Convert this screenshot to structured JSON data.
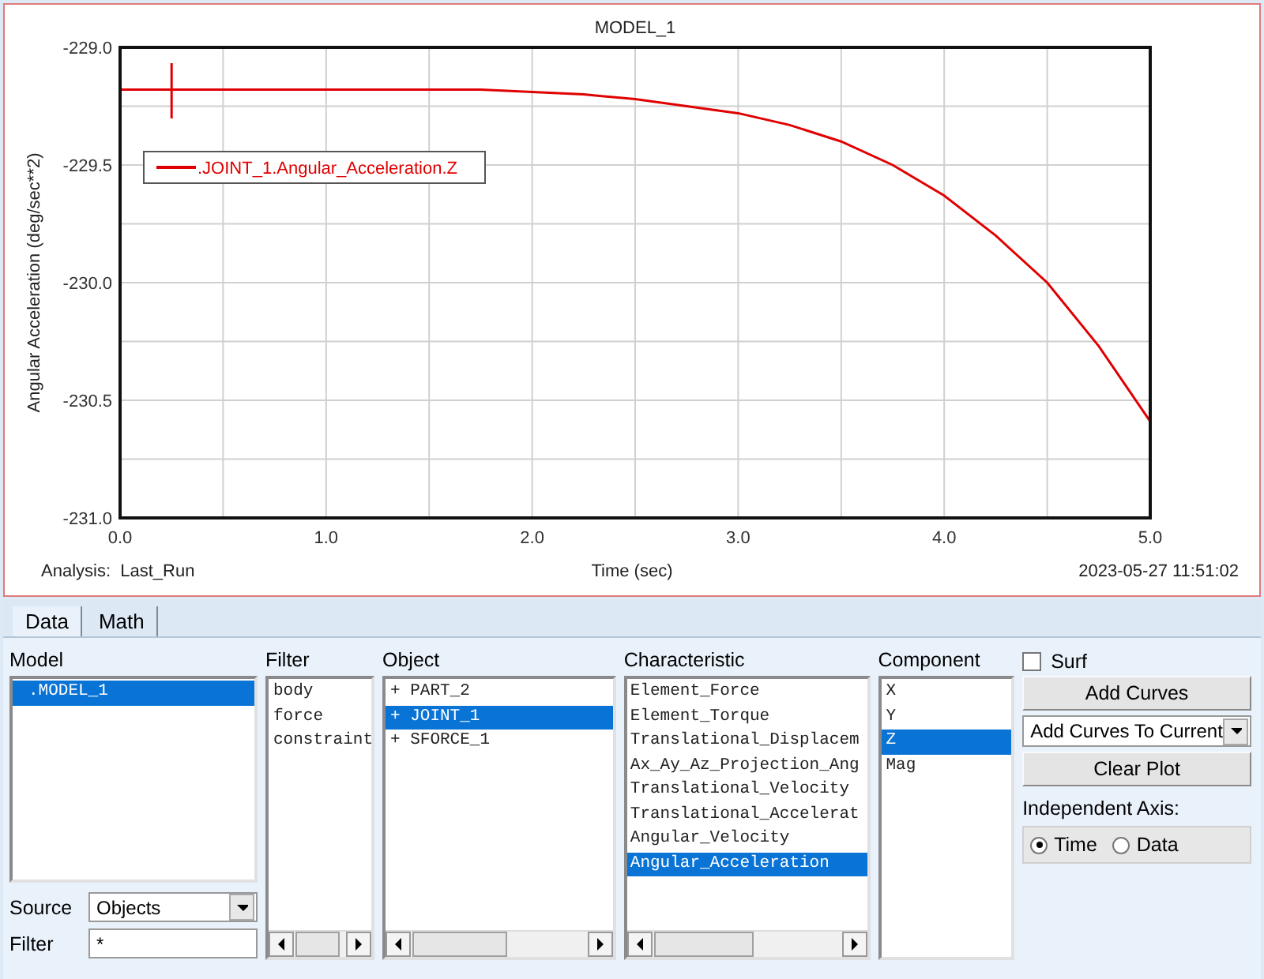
{
  "plot": {
    "chart_data": {
      "type": "line",
      "title": "MODEL_1",
      "xlabel": "Time (sec)",
      "ylabel": "Angular Acceleration (deg/sec**2)",
      "x": [
        0,
        0.25,
        0.5,
        0.75,
        1,
        1.25,
        1.5,
        1.75,
        2,
        2.25,
        2.5,
        2.75,
        3,
        3.25,
        3.5,
        3.75,
        4,
        4.25,
        4.5,
        4.75,
        5
      ],
      "series": [
        {
          "name": ".JOINT_1.Angular_Acceleration.Z",
          "color": "#e00000",
          "values": [
            -229.18,
            -229.18,
            -229.18,
            -229.18,
            -229.18,
            -229.18,
            -229.18,
            -229.18,
            -229.19,
            -229.2,
            -229.22,
            -229.25,
            -229.28,
            -229.33,
            -229.4,
            -229.5,
            -229.63,
            -229.8,
            -230.0,
            -230.27,
            -230.59
          ]
        }
      ],
      "xlim": [
        0,
        5
      ],
      "ylim": [
        -231,
        -229
      ],
      "grid": true,
      "xticks": [
        {
          "value": 0,
          "label": "0.0"
        },
        {
          "value": 1,
          "label": "1.0"
        },
        {
          "value": 2,
          "label": "2.0"
        },
        {
          "value": 3,
          "label": "3.0"
        },
        {
          "value": 4,
          "label": "4.0"
        },
        {
          "value": 5,
          "label": "5.0"
        }
      ],
      "yticks": [
        {
          "value": -229,
          "label": "-229.0"
        },
        {
          "value": -229.5,
          "label": "-229.5"
        },
        {
          "value": -230,
          "label": "-230.0"
        },
        {
          "value": -230.5,
          "label": "-230.5"
        },
        {
          "value": -231,
          "label": "-231.0"
        }
      ]
    },
    "analysis": "Analysis:  Last_Run",
    "timestamp": "2023-05-27 11:51:02"
  },
  "tabs": [
    {
      "label": "Data",
      "selected": true
    },
    {
      "label": "Math",
      "selected": false
    }
  ],
  "model": {
    "label": "Model",
    "items": [
      {
        "label": ".MODEL_1",
        "selected": true
      }
    ]
  },
  "source": {
    "label": "Source",
    "value": "Objects"
  },
  "filter_field": {
    "label": "Filter",
    "value": "*"
  },
  "filter_list": {
    "label": "Filter",
    "items": [
      {
        "label": "body",
        "selected": false
      },
      {
        "label": "force",
        "selected": false
      },
      {
        "label": "constraint",
        "selected": false
      }
    ]
  },
  "object": {
    "label": "Object",
    "items": [
      {
        "label": "+ PART_2",
        "selected": false
      },
      {
        "label": "+ JOINT_1",
        "selected": true
      },
      {
        "label": "+ SFORCE_1",
        "selected": false
      }
    ]
  },
  "characteristic": {
    "label": "Characteristic",
    "items": [
      {
        "label": "Element_Force",
        "selected": false
      },
      {
        "label": "Element_Torque",
        "selected": false
      },
      {
        "label": "Translational_Displacem",
        "selected": false
      },
      {
        "label": "Ax_Ay_Az_Projection_Ang",
        "selected": false
      },
      {
        "label": "Translational_Velocity",
        "selected": false
      },
      {
        "label": "Translational_Accelerat",
        "selected": false
      },
      {
        "label": "Angular_Velocity",
        "selected": false
      },
      {
        "label": "Angular_Acceleration",
        "selected": true
      }
    ]
  },
  "component": {
    "label": "Component",
    "items": [
      {
        "label": "X",
        "selected": false
      },
      {
        "label": "Y",
        "selected": false
      },
      {
        "label": "Z",
        "selected": true
      },
      {
        "label": "Mag",
        "selected": false
      }
    ]
  },
  "surf": {
    "label": "Surf",
    "checked": false
  },
  "add_curves": "Add Curves",
  "add_mode": {
    "value": "Add Curves To Current"
  },
  "clear_plot": "Clear Plot",
  "independent_axis": {
    "label": "Independent Axis:",
    "options": [
      {
        "label": "Time",
        "selected": true
      },
      {
        "label": "Data",
        "selected": false
      }
    ]
  }
}
